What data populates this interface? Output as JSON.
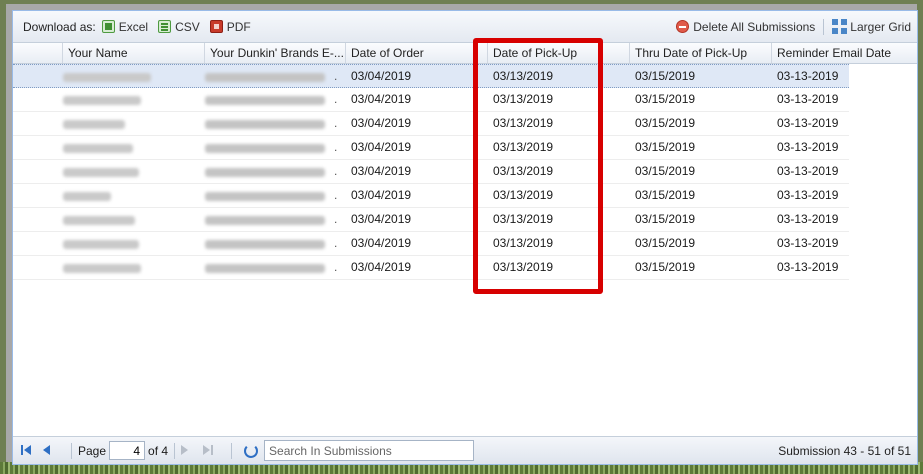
{
  "toolbar": {
    "download_label": "Download as:",
    "excel_label": "Excel",
    "csv_label": "CSV",
    "pdf_label": "PDF",
    "delete_all_label": "Delete All Submissions",
    "larger_grid_label": "Larger Grid"
  },
  "columns": [
    "Your Name",
    "Your Dunkin' Brands E-...",
    "Date of Order",
    "Date of Pick-Up",
    "Thru Date of Pick-Up",
    "Reminder Email Date"
  ],
  "rows": [
    {
      "date_order": "03/04/2019",
      "date_pickup": "03/13/2019",
      "thru_date": "03/15/2019",
      "reminder": "03-13-2019",
      "selected": true
    },
    {
      "date_order": "03/04/2019",
      "date_pickup": "03/13/2019",
      "thru_date": "03/15/2019",
      "reminder": "03-13-2019"
    },
    {
      "date_order": "03/04/2019",
      "date_pickup": "03/13/2019",
      "thru_date": "03/15/2019",
      "reminder": "03-13-2019"
    },
    {
      "date_order": "03/04/2019",
      "date_pickup": "03/13/2019",
      "thru_date": "03/15/2019",
      "reminder": "03-13-2019"
    },
    {
      "date_order": "03/04/2019",
      "date_pickup": "03/13/2019",
      "thru_date": "03/15/2019",
      "reminder": "03-13-2019"
    },
    {
      "date_order": "03/04/2019",
      "date_pickup": "03/13/2019",
      "thru_date": "03/15/2019",
      "reminder": "03-13-2019"
    },
    {
      "date_order": "03/04/2019",
      "date_pickup": "03/13/2019",
      "thru_date": "03/15/2019",
      "reminder": "03-13-2019"
    },
    {
      "date_order": "03/04/2019",
      "date_pickup": "03/13/2019",
      "thru_date": "03/15/2019",
      "reminder": "03-13-2019"
    },
    {
      "date_order": "03/04/2019",
      "date_pickup": "03/13/2019",
      "thru_date": "03/15/2019",
      "reminder": "03-13-2019"
    }
  ],
  "pager": {
    "page_label": "Page",
    "page_value": "4",
    "of_label": "of 4",
    "search_placeholder": "Search In Submissions",
    "info": "Submission 43 - 51 of 51"
  },
  "colors": {
    "highlight": "#d70000",
    "selected_row": "#dfe8f6",
    "accent": "#2e6fc4"
  }
}
